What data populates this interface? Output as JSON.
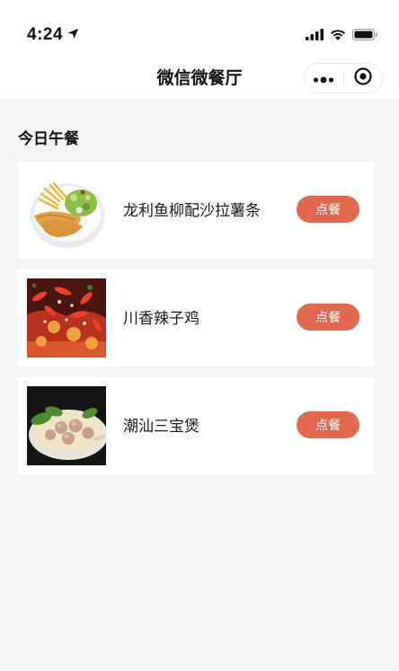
{
  "status_bar": {
    "time": "4:24"
  },
  "nav": {
    "title": "微信微餐厅"
  },
  "section": {
    "title": "今日午餐"
  },
  "menu": {
    "items": [
      {
        "name": "龙利鱼柳配沙拉薯条",
        "button": "点餐",
        "image": "fish-fillet-salad-fries"
      },
      {
        "name": "川香辣子鸡",
        "button": "点餐",
        "image": "spicy-chicken"
      },
      {
        "name": "潮汕三宝煲",
        "button": "点餐",
        "image": "chaoshan-meatball-pot"
      }
    ]
  },
  "colors": {
    "accent": "#e3684f",
    "background": "#f4f4f4"
  }
}
